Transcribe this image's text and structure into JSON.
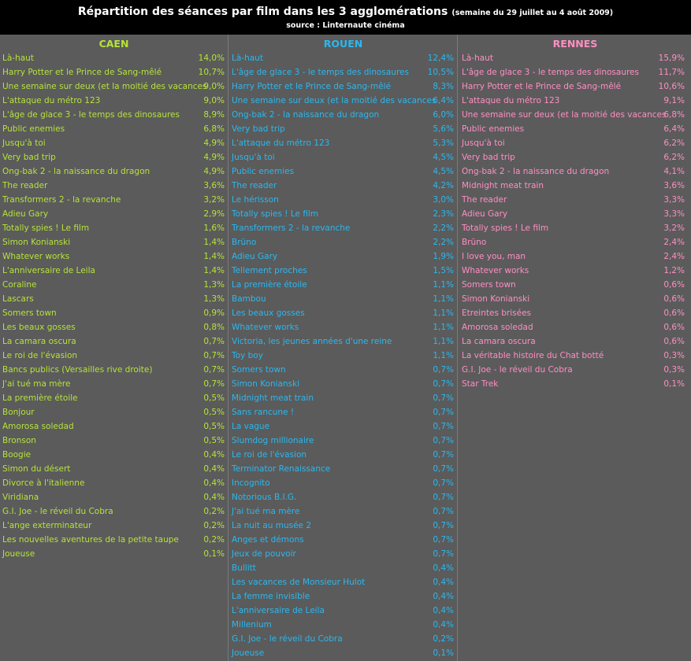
{
  "header": {
    "title": "Répartition des séances par film dans les 3 agglomérations",
    "subtitle": "(semaine du 29 juillet au 4 août 2009)",
    "source": "source : Linternaute cinéma"
  },
  "colors": {
    "caen": "#b6e33a",
    "rouen": "#2ab8f0",
    "rennes": "#ff8ec3"
  },
  "chart_data": {
    "type": "table",
    "columns": [
      {
        "city": "CAEN",
        "rows": [
          {
            "film": "Là-haut",
            "share": "14,0%"
          },
          {
            "film": "Harry Potter et le Prince de Sang-mêlé",
            "share": "10,7%"
          },
          {
            "film": "Une semaine sur deux (et la moitié des vacances",
            "share": "9,0%"
          },
          {
            "film": "L'attaque du métro 123",
            "share": "9,0%"
          },
          {
            "film": "L'âge de glace 3 - le temps des dinosaures",
            "share": "8,9%"
          },
          {
            "film": "Public enemies",
            "share": "6,8%"
          },
          {
            "film": "Jusqu'à toi",
            "share": "4,9%"
          },
          {
            "film": "Very bad trip",
            "share": "4,9%"
          },
          {
            "film": "Ong-bak 2 - la naissance du dragon",
            "share": "4,9%"
          },
          {
            "film": "The reader",
            "share": "3,6%"
          },
          {
            "film": "Transformers 2 - la revanche",
            "share": "3,2%"
          },
          {
            "film": "Adieu Gary",
            "share": "2,9%"
          },
          {
            "film": "Totally spies ! Le film",
            "share": "1,6%"
          },
          {
            "film": "Simon Konianski",
            "share": "1,4%"
          },
          {
            "film": "Whatever works",
            "share": "1,4%"
          },
          {
            "film": "L'anniversaire de Leila",
            "share": "1,4%"
          },
          {
            "film": "Coraline",
            "share": "1,3%"
          },
          {
            "film": "Lascars",
            "share": "1,3%"
          },
          {
            "film": "Somers town",
            "share": "0,9%"
          },
          {
            "film": "Les beaux gosses",
            "share": "0,8%"
          },
          {
            "film": "La camara oscura",
            "share": "0,7%"
          },
          {
            "film": "Le roi de l'évasion",
            "share": "0,7%"
          },
          {
            "film": "Bancs publics (Versailles rive droite)",
            "share": "0,7%"
          },
          {
            "film": "J'ai tué ma mère",
            "share": "0,7%"
          },
          {
            "film": "La première étoile",
            "share": "0,5%"
          },
          {
            "film": "Bonjour",
            "share": "0,5%"
          },
          {
            "film": "Amorosa soledad",
            "share": "0,5%"
          },
          {
            "film": "Bronson",
            "share": "0,5%"
          },
          {
            "film": "Boogie",
            "share": "0,4%"
          },
          {
            "film": "Simon du désert",
            "share": "0,4%"
          },
          {
            "film": "Divorce à l'italienne",
            "share": "0,4%"
          },
          {
            "film": "Viridiana",
            "share": "0,4%"
          },
          {
            "film": "G.I. Joe - le réveil du Cobra",
            "share": "0,2%"
          },
          {
            "film": "L'ange exterminateur",
            "share": "0,2%"
          },
          {
            "film": "Les nouvelles aventures de la petite taupe",
            "share": "0,2%"
          },
          {
            "film": "Joueuse",
            "share": "0,1%"
          }
        ]
      },
      {
        "city": "ROUEN",
        "rows": [
          {
            "film": "Là-haut",
            "share": "12,4%"
          },
          {
            "film": "L'âge de glace 3 - le temps des dinosaures",
            "share": "10,5%"
          },
          {
            "film": "Harry Potter et le Prince de Sang-mêlé",
            "share": "8,3%"
          },
          {
            "film": "Une semaine sur deux (et la moitié des vacances",
            "share": "6,4%"
          },
          {
            "film": "Ong-bak 2 - la naissance du dragon",
            "share": "6,0%"
          },
          {
            "film": "Very bad trip",
            "share": "5,6%"
          },
          {
            "film": "L'attaque du métro 123",
            "share": "5,3%"
          },
          {
            "film": "Jusqu'à toi",
            "share": "4,5%"
          },
          {
            "film": "Public enemies",
            "share": "4,5%"
          },
          {
            "film": "The reader",
            "share": "4,2%"
          },
          {
            "film": "Le hérisson",
            "share": "3,0%"
          },
          {
            "film": "Totally spies ! Le film",
            "share": "2,3%"
          },
          {
            "film": "Transformers 2 - la revanche",
            "share": "2,2%"
          },
          {
            "film": "Brüno",
            "share": "2,2%"
          },
          {
            "film": "Adieu Gary",
            "share": "1,9%"
          },
          {
            "film": "Tellement proches",
            "share": "1,5%"
          },
          {
            "film": "La première étoile",
            "share": "1,1%"
          },
          {
            "film": "Bambou",
            "share": "1,1%"
          },
          {
            "film": "Les beaux gosses",
            "share": "1,1%"
          },
          {
            "film": "Whatever works",
            "share": "1,1%"
          },
          {
            "film": "Victoria, les jeunes années d'une reine",
            "share": "1,1%"
          },
          {
            "film": "Toy boy",
            "share": "1,1%"
          },
          {
            "film": "Somers town",
            "share": "0,7%"
          },
          {
            "film": "Simon Konianski",
            "share": "0,7%"
          },
          {
            "film": "Midnight meat train",
            "share": "0,7%"
          },
          {
            "film": "Sans rancune !",
            "share": "0,7%"
          },
          {
            "film": "La vague",
            "share": "0,7%"
          },
          {
            "film": "Slumdog millionaire",
            "share": "0,7%"
          },
          {
            "film": "Le roi de l'évasion",
            "share": "0,7%"
          },
          {
            "film": "Terminator Renaissance",
            "share": "0,7%"
          },
          {
            "film": "Incognito",
            "share": "0,7%"
          },
          {
            "film": "Notorious B.I.G.",
            "share": "0,7%"
          },
          {
            "film": "J'ai tué ma mère",
            "share": "0,7%"
          },
          {
            "film": "La nuit au musée 2",
            "share": "0,7%"
          },
          {
            "film": "Anges et démons",
            "share": "0,7%"
          },
          {
            "film": "Jeux de pouvoir",
            "share": "0,7%"
          },
          {
            "film": "Bullitt",
            "share": "0,4%"
          },
          {
            "film": "Les vacances de Monsieur Hulot",
            "share": "0,4%"
          },
          {
            "film": "La femme invisible",
            "share": "0,4%"
          },
          {
            "film": "L'anniversaire de Leila",
            "share": "0,4%"
          },
          {
            "film": "Millenium",
            "share": "0,4%"
          },
          {
            "film": "G.I. Joe - le réveil du Cobra",
            "share": "0,2%"
          },
          {
            "film": "Joueuse",
            "share": "0,1%"
          }
        ]
      },
      {
        "city": "RENNES",
        "rows": [
          {
            "film": "Là-haut",
            "share": "15,9%"
          },
          {
            "film": "L'âge de glace 3 - le temps des dinosaures",
            "share": "11,7%"
          },
          {
            "film": "Harry Potter et le Prince de Sang-mêlé",
            "share": "10,6%"
          },
          {
            "film": "L'attaque du métro 123",
            "share": "9,1%"
          },
          {
            "film": "Une semaine sur deux (et la moitié des vacances",
            "share": "6,8%"
          },
          {
            "film": "Public enemies",
            "share": "6,4%"
          },
          {
            "film": "Jusqu'à toi",
            "share": "6,2%"
          },
          {
            "film": "Very bad trip",
            "share": "6,2%"
          },
          {
            "film": "Ong-bak 2 - la naissance du dragon",
            "share": "4,1%"
          },
          {
            "film": "Midnight meat train",
            "share": "3,6%"
          },
          {
            "film": "The reader",
            "share": "3,3%"
          },
          {
            "film": "Adieu Gary",
            "share": "3,3%"
          },
          {
            "film": "Totally spies ! Le film",
            "share": "3,2%"
          },
          {
            "film": "Brüno",
            "share": "2,4%"
          },
          {
            "film": "I love you, man",
            "share": "2,4%"
          },
          {
            "film": "Whatever works",
            "share": "1,2%"
          },
          {
            "film": "Somers town",
            "share": "0,6%"
          },
          {
            "film": "Simon Konianski",
            "share": "0,6%"
          },
          {
            "film": "Etreintes brisées",
            "share": "0,6%"
          },
          {
            "film": "Amorosa soledad",
            "share": "0,6%"
          },
          {
            "film": "La camara oscura",
            "share": "0,6%"
          },
          {
            "film": "La véritable histoire du Chat botté",
            "share": "0,3%"
          },
          {
            "film": "G.I. Joe - le réveil du Cobra",
            "share": "0,3%"
          },
          {
            "film": "Star Trek",
            "share": "0,1%"
          }
        ]
      }
    ]
  }
}
